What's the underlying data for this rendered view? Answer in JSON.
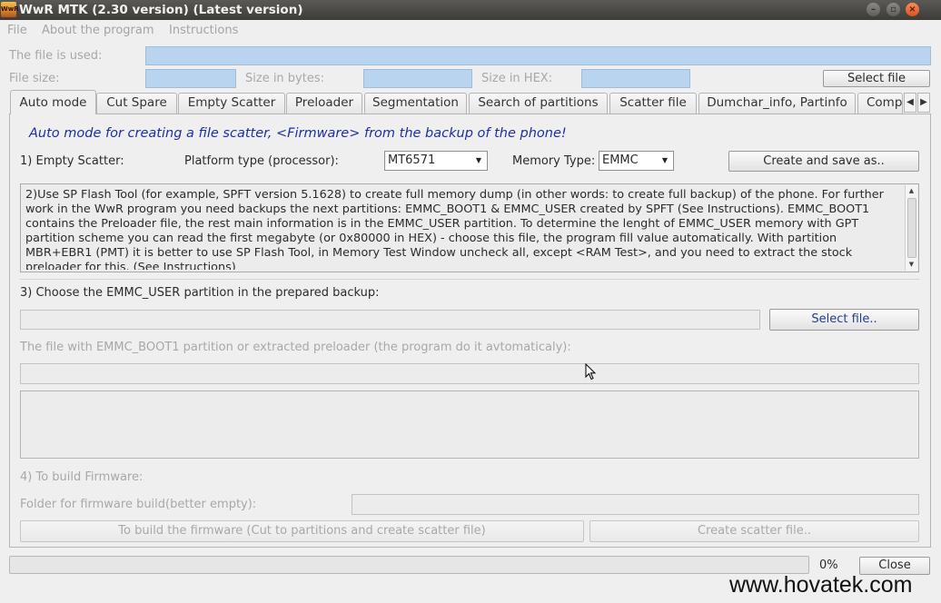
{
  "window": {
    "title": "WwR MTK (2.30 version) (Latest version)",
    "icon_text": "WwR",
    "controls": [
      "minimize",
      "maximize",
      "close"
    ]
  },
  "menu": [
    "File",
    "About the program",
    "Instructions"
  ],
  "file_info": {
    "file_used_label": "The file is used:",
    "file_size_label": "File size:",
    "size_bytes_label": "Size in bytes:",
    "size_hex_label": "Size in HEX:",
    "select_file_button": "Select file"
  },
  "tabs": [
    "Auto mode",
    "Cut Spare",
    "Empty Scatter",
    "Preloader",
    "Segmentation",
    "Search of partitions",
    "Scatter file",
    "Dumchar_info, Partinfo",
    "Compa"
  ],
  "active_tab": "Auto mode",
  "auto_mode": {
    "header": "Auto mode for creating a file scatter, <Firmware> from the backup of the phone!",
    "step1_label": "1) Empty Scatter:",
    "platform_label": "Platform type (processor):",
    "platform_value": "MT6571",
    "memory_type_label": "Memory Type:",
    "memory_type_value": "EMMC",
    "create_save_button": "Create and save as..",
    "step2_text": "2)Use SP Flash Tool (for example, SPFT version 5.1628) to create full memory dump (in other words: to create full backup) of the phone. For further work in the WwR program you need backups the next partitions: EMMC_BOOT1 & EMMC_USER created by SPFT (See Instructions). EMMC_BOOT1 contains the Preloader file, the rest main information is in the EMMC_USER partition. To determine the lenght of EMMC_USER memory with GPT partition scheme you can read the first megabyte (or 0x80000 in HEX) - choose this file, the program fill value automatically. With partition MBR+EBR1 (PMT) it is better to use SP Flash Tool, in Memory Test Window uncheck all, except <RAM Test>, and you need to extract the stock preloader for this. (See Instructions)",
    "step3_label": "3) Choose the EMMC_USER partition in the prepared backup:",
    "select_file_button": "Select file..",
    "boot1_label": "The file with EMMC_BOOT1 partition or extracted preloader (the program do it avtomaticaly):",
    "step4_label": "4) To build Firmware:",
    "folder_label": "Folder for firmware build(better empty):",
    "build_button": "To build the firmware (Cut to partitions and create scatter file)",
    "create_scatter_button": "Create scatter file.."
  },
  "footer": {
    "progress_percent": 0,
    "progress_text": "0%",
    "close_button": "Close"
  },
  "watermark": "www.hovatek.com",
  "colors": {
    "accent_field": "#b9d4ef",
    "header_text": "#1c2fa5",
    "titlebar": "#4a4945",
    "close_control": "#e8632c"
  }
}
